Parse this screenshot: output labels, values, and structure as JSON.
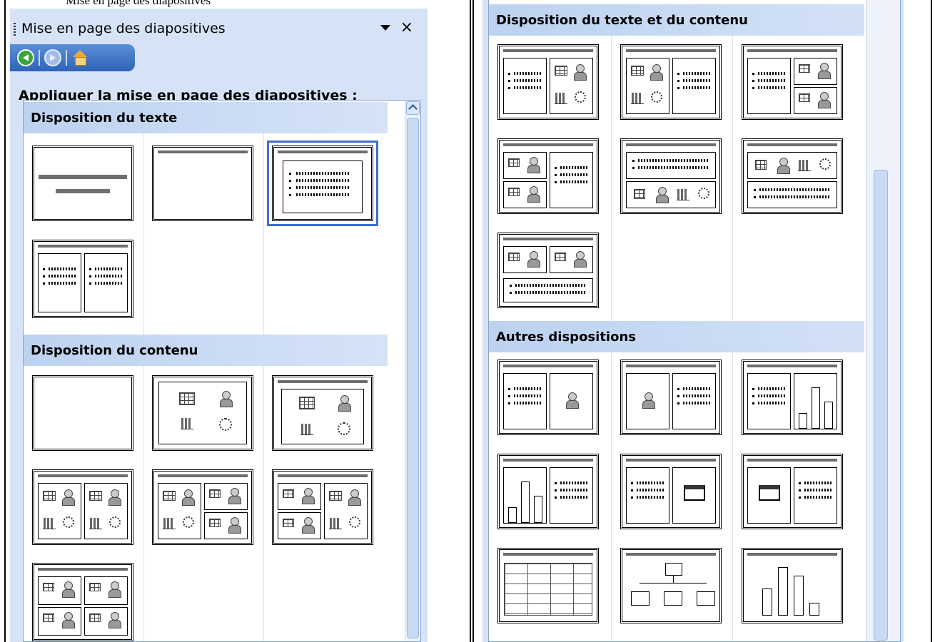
{
  "caption_fragment": "Mise en page des diapositives",
  "left_pane": {
    "title": "Mise en page des diapositives",
    "dropdown_icon": "triangle-down-icon",
    "close_label": "×",
    "nav": [
      "back-icon",
      "forward-icon",
      "home-icon"
    ],
    "subtitle": "Appliquer la mise en page des diapositives :",
    "sections": {
      "text": "Disposition du texte",
      "content": "Disposition du contenu"
    }
  },
  "right_pane": {
    "sections": {
      "text_content": "Disposition du texte et du contenu",
      "other": "Autres dispositions"
    }
  },
  "colors": {
    "pane_bg": "#d6e3f7",
    "selection": "#3d6fd1"
  }
}
